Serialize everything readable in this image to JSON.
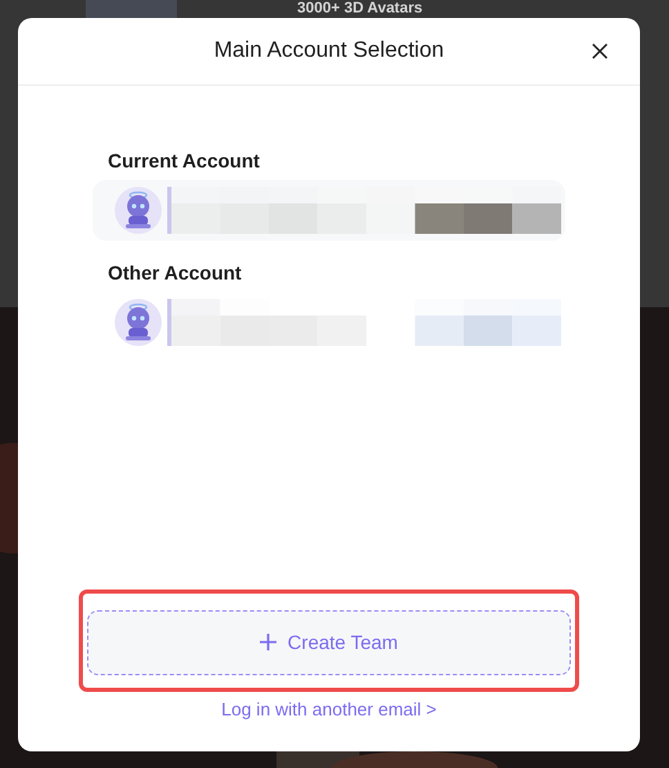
{
  "background": {
    "headline": "3000+ 3D Avatars"
  },
  "dialog": {
    "title": "Main Account Selection",
    "sections": [
      {
        "heading": "Current Account",
        "accounts": [
          {
            "selected": true
          }
        ]
      },
      {
        "heading": "Other Account",
        "accounts": [
          {
            "selected": false
          }
        ]
      }
    ],
    "create_button": {
      "label": "Create Team",
      "highlighted": true
    },
    "link": "Log in with another email >"
  }
}
